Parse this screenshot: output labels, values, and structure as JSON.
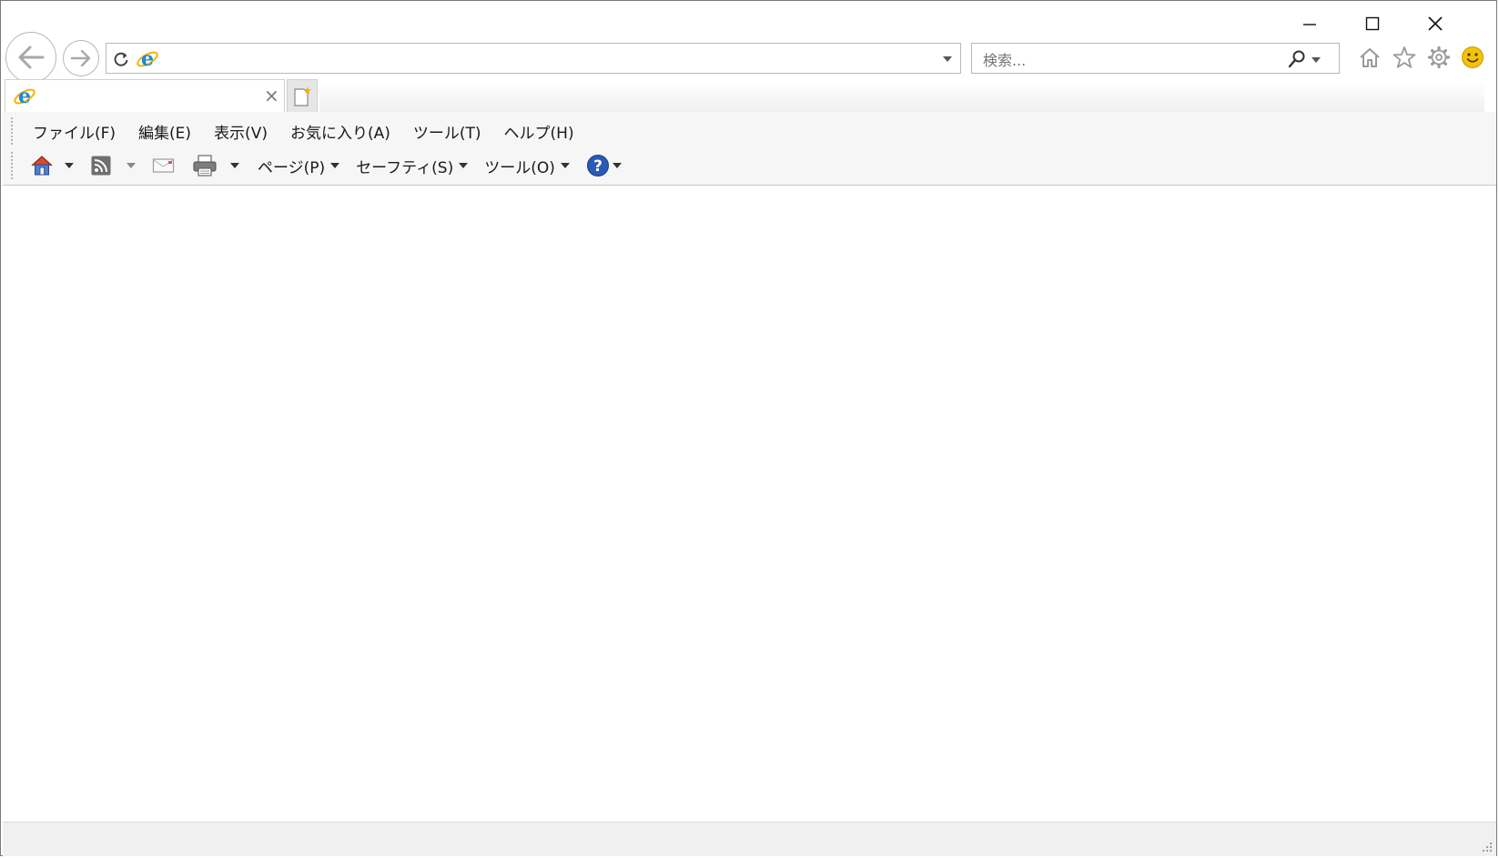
{
  "window": {
    "caption_buttons": [
      "minimize-icon",
      "maximize-icon",
      "close-icon"
    ]
  },
  "nav": {
    "back_icon": "back-arrow-icon",
    "forward_icon": "forward-arrow-icon"
  },
  "address_bar": {
    "value": "",
    "icons": [
      "refresh-icon",
      "ie-logo-icon",
      "dropdown-caret-icon"
    ]
  },
  "search": {
    "placeholder": "検索...",
    "value": ""
  },
  "right_toolbar": {
    "icons": [
      "home-icon",
      "favorites-star-icon",
      "settings-gear-icon",
      "feedback-smiley-icon"
    ]
  },
  "tabs": [
    {
      "title": "",
      "close": "×"
    }
  ],
  "menu_bar": {
    "items": [
      "ファイル(F)",
      "編集(E)",
      "表示(V)",
      "お気に入り(A)",
      "ツール(T)",
      "ヘルプ(H)"
    ]
  },
  "command_bar": {
    "items": [
      {
        "icon": "home-icon",
        "label": "",
        "dropdown": true
      },
      {
        "icon": "rss-feed-icon",
        "label": "",
        "dropdown": true
      },
      {
        "icon": "mail-icon",
        "label": "",
        "dropdown": false
      },
      {
        "icon": "print-icon",
        "label": "",
        "dropdown": true
      },
      {
        "icon": "",
        "label": "ページ(P)",
        "dropdown": true
      },
      {
        "icon": "",
        "label": "セーフティ(S)",
        "dropdown": true
      },
      {
        "icon": "",
        "label": "ツール(O)",
        "dropdown": true
      },
      {
        "icon": "help-icon",
        "label": "",
        "dropdown": true
      }
    ]
  },
  "colors": {
    "ie_blue": "#1e88d6",
    "ie_orange": "#f4b400",
    "help_blue": "#2a5ab8",
    "smiley_yellow": "#f4c20d"
  }
}
